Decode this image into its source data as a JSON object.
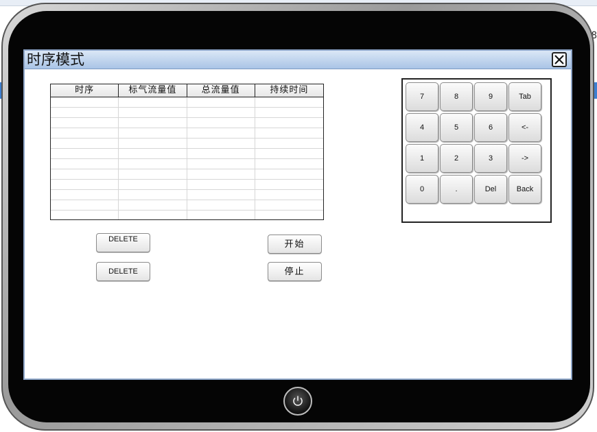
{
  "window": {
    "title": "时序模式"
  },
  "table": {
    "columns": [
      "时序",
      "标气流量值",
      "总流量值",
      "持续时间"
    ],
    "rows": [
      [
        "",
        "",
        "",
        ""
      ],
      [
        "",
        "",
        "",
        ""
      ],
      [
        "",
        "",
        "",
        ""
      ],
      [
        "",
        "",
        "",
        ""
      ],
      [
        "",
        "",
        "",
        ""
      ],
      [
        "",
        "",
        "",
        ""
      ],
      [
        "",
        "",
        "",
        ""
      ],
      [
        "",
        "",
        "",
        ""
      ],
      [
        "",
        "",
        "",
        ""
      ],
      [
        "",
        "",
        "",
        ""
      ],
      [
        "",
        "",
        "",
        ""
      ],
      [
        "",
        "",
        "",
        ""
      ]
    ]
  },
  "buttons": {
    "delete1": "DELETE",
    "delete2": "DELETE",
    "start": "开始",
    "stop": "停止"
  },
  "keypad": {
    "keys": [
      "7",
      "8",
      "9",
      "Tab",
      "4",
      "5",
      "6",
      "<-",
      "1",
      "2",
      "3",
      "->",
      "0",
      ".",
      "Del",
      "Back"
    ]
  },
  "background": {
    "right_char": "8"
  },
  "colors": {
    "titlebar": "#a9c4e6",
    "bezel": "#050505",
    "accent_blue": "#3d7fd1"
  }
}
